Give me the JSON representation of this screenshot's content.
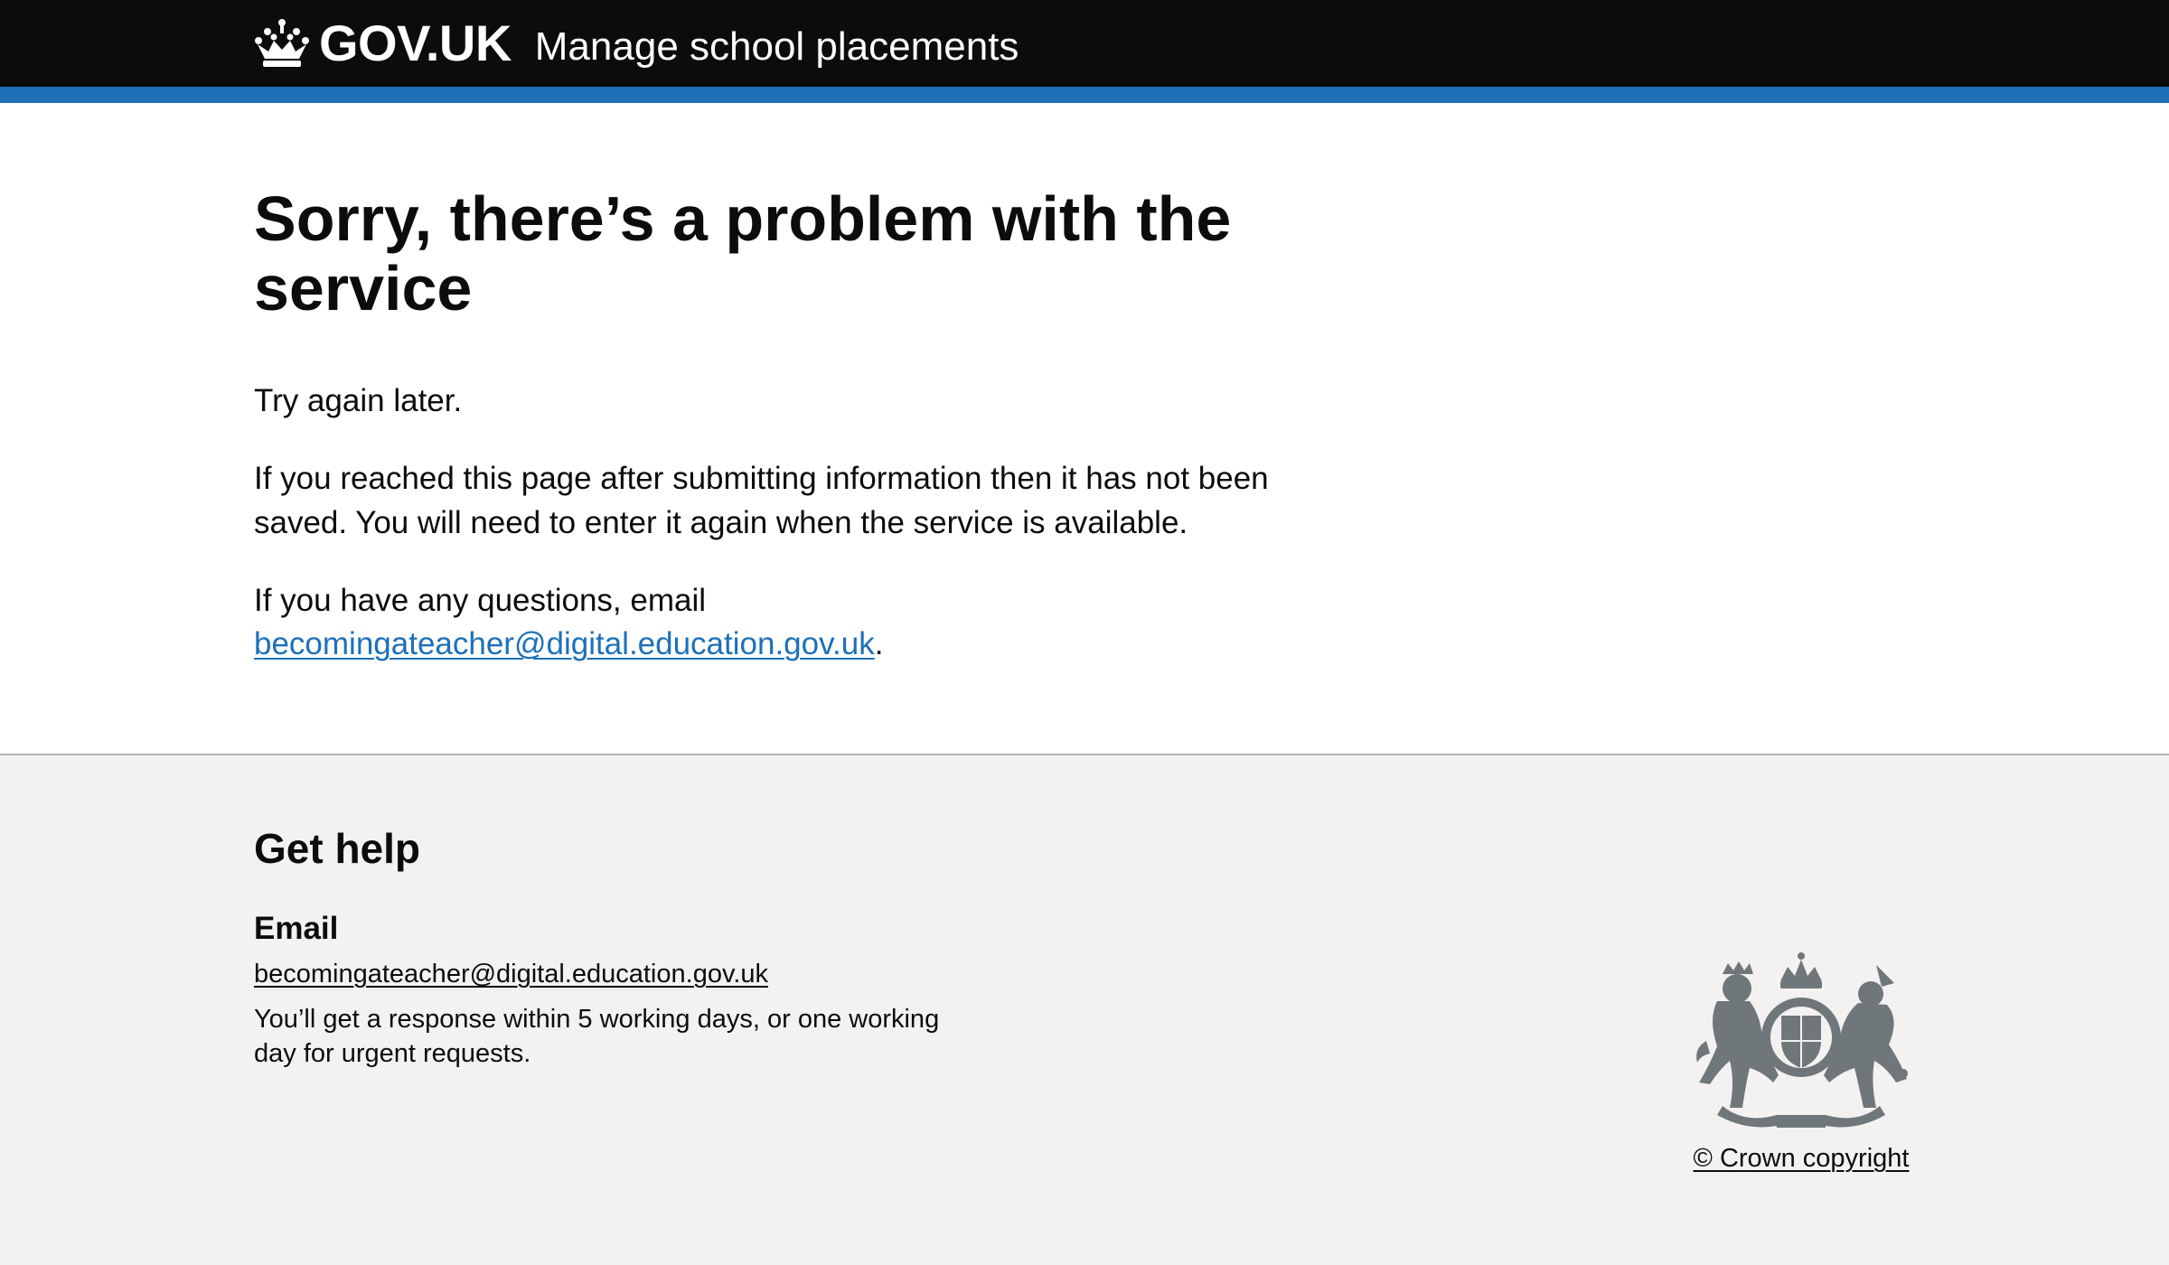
{
  "header": {
    "logo_text": "GOV.UK",
    "service_name": "Manage school placements",
    "icon": "crown-icon"
  },
  "main": {
    "title": "Sorry, there’s a problem with the service",
    "paragraph_1": "Try again later.",
    "paragraph_2": "If you reached this page after submitting information then it has not been saved. You will need to enter it again when the service is available.",
    "paragraph_3_prefix": "If you have any questions, email",
    "paragraph_3_link": "becomingateacher@digital.education.gov.uk",
    "paragraph_3_suffix": "."
  },
  "footer": {
    "heading": "Get help",
    "email_heading": "Email",
    "email_link": "becomingateacher@digital.education.gov.uk",
    "response_note": "You’ll get a response within 5 working days, or one working day for urgent requests.",
    "copyright": "© Crown copyright",
    "crest_icon": "royal-coat-of-arms-icon"
  },
  "colors": {
    "header_bg": "#0b0c0c",
    "accent_bar": "#1d70b8",
    "link": "#1d70b8",
    "footer_bg": "#f3f2f1",
    "crest": "#6f777b"
  }
}
